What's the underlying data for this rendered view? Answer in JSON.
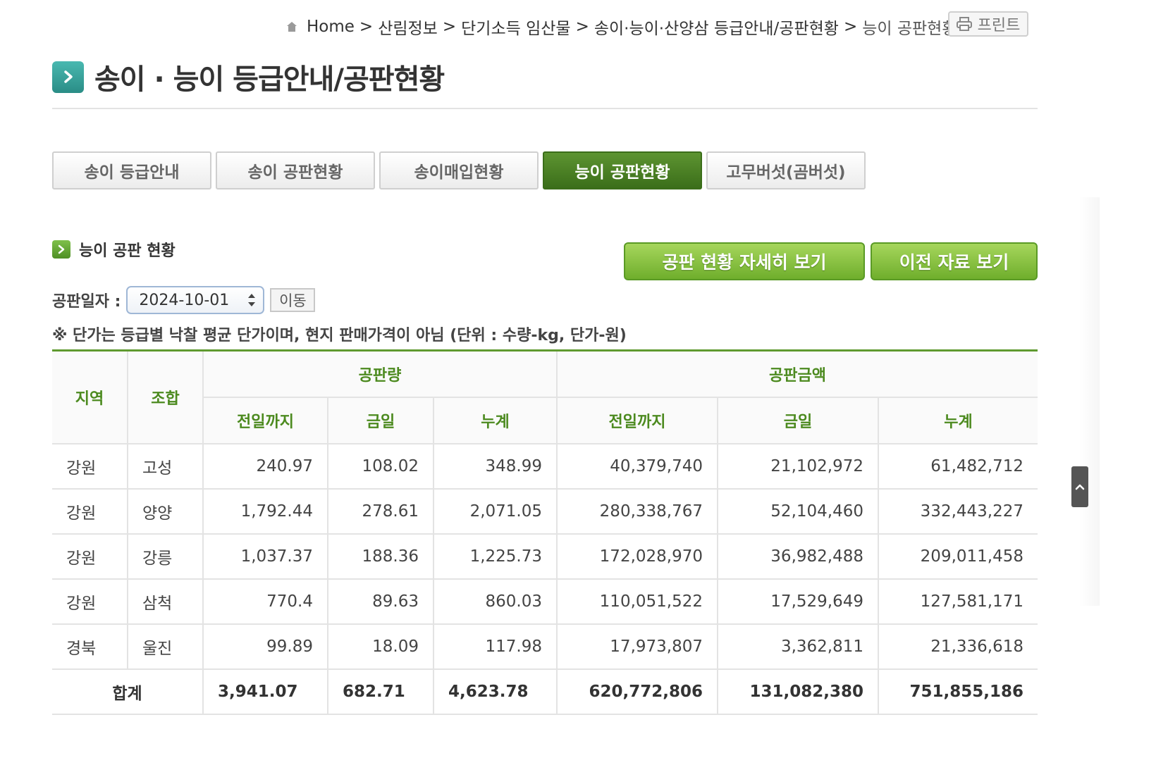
{
  "breadcrumb": {
    "items": [
      "Home",
      "산림정보",
      "단기소득 임산물",
      "송이·능이·산양삼 등급안내/공판현황",
      "능이 공판현황"
    ],
    "separator": ">"
  },
  "print_button": {
    "label": "프린트"
  },
  "page_title": "송이 · 능이 등급안내/공판현황",
  "tabs": [
    {
      "label": "송이 등급안내",
      "active": false
    },
    {
      "label": "송이 공판현황",
      "active": false
    },
    {
      "label": "송이매입현황",
      "active": false
    },
    {
      "label": "능이 공판현황",
      "active": true
    },
    {
      "label": "고무버섯(곰버섯)",
      "active": false
    }
  ],
  "section_title": "능이 공판 현황",
  "buttons": {
    "detail": "공판 현황 자세히 보기",
    "previous": "이전 자료 보기"
  },
  "date_filter": {
    "label": "공판일자 :",
    "value": "2024-10-01",
    "go_label": "이동"
  },
  "note": "※ 단가는 등급별 낙찰 평균 단가이며, 현지 판매가격이 아님 (단위 : 수량-kg, 단가-원)",
  "table": {
    "headers": {
      "region": "지역",
      "union": "조합",
      "volume_group": "공판량",
      "amount_group": "공판금액",
      "sub": [
        "전일까지",
        "금일",
        "누계",
        "전일까지",
        "금일",
        "누계"
      ]
    },
    "rows": [
      [
        "강원",
        "고성",
        "240.97",
        "108.02",
        "348.99",
        "40,379,740",
        "21,102,972",
        "61,482,712"
      ],
      [
        "강원",
        "양양",
        "1,792.44",
        "278.61",
        "2,071.05",
        "280,338,767",
        "52,104,460",
        "332,443,227"
      ],
      [
        "강원",
        "강릉",
        "1,037.37",
        "188.36",
        "1,225.73",
        "172,028,970",
        "36,982,488",
        "209,011,458"
      ],
      [
        "강원",
        "삼척",
        "770.4",
        "89.63",
        "860.03",
        "110,051,522",
        "17,529,649",
        "127,581,171"
      ],
      [
        "경북",
        "울진",
        "99.89",
        "18.09",
        "117.98",
        "17,973,807",
        "3,362,811",
        "21,336,618"
      ]
    ],
    "total": {
      "label": "합계",
      "values": [
        "3,941.07",
        "682.71",
        "4,623.78",
        "620,772,806",
        "131,082,380",
        "751,855,186"
      ]
    }
  },
  "colors": {
    "accent_green": "#4c8a1f",
    "active_tab": "#3b6e1a",
    "button_green": "#7fbb34",
    "title_icon": "#3aa69e"
  },
  "icons": [
    "home-icon",
    "printer-icon",
    "chevron-right-icon",
    "select-arrows-icon",
    "arrow-up-icon"
  ]
}
